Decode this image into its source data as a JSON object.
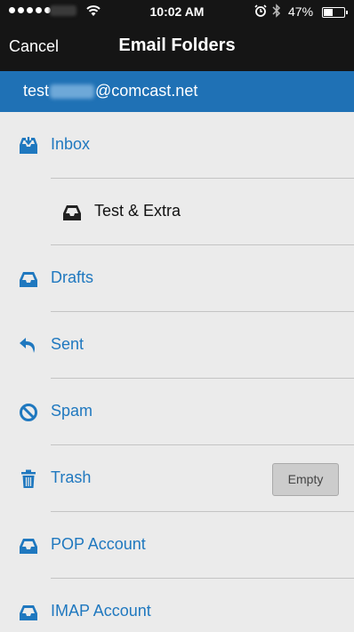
{
  "status_bar": {
    "time": "10:02 AM",
    "battery_text": "47%",
    "battery_level": 0.47
  },
  "nav": {
    "cancel_label": "Cancel",
    "title": "Email Folders"
  },
  "account": {
    "email_prefix": "test",
    "email_domain": "@comcast.net"
  },
  "colors": {
    "accent": "#1f71b5",
    "link": "#1f78bf",
    "bar": "#151515"
  },
  "folders": [
    {
      "label": "Inbox",
      "icon": "inbox-download-icon"
    },
    {
      "label": "Test & Extra",
      "icon": "tray-icon"
    },
    {
      "label": "Drafts",
      "icon": "tray-icon"
    },
    {
      "label": "Sent",
      "icon": "reply-arrow-icon"
    },
    {
      "label": "Spam",
      "icon": "prohibited-icon"
    },
    {
      "label": "Trash",
      "icon": "trash-icon",
      "action_label": "Empty"
    },
    {
      "label": "POP Account",
      "icon": "tray-icon"
    },
    {
      "label": "IMAP Account",
      "icon": "tray-icon"
    }
  ]
}
